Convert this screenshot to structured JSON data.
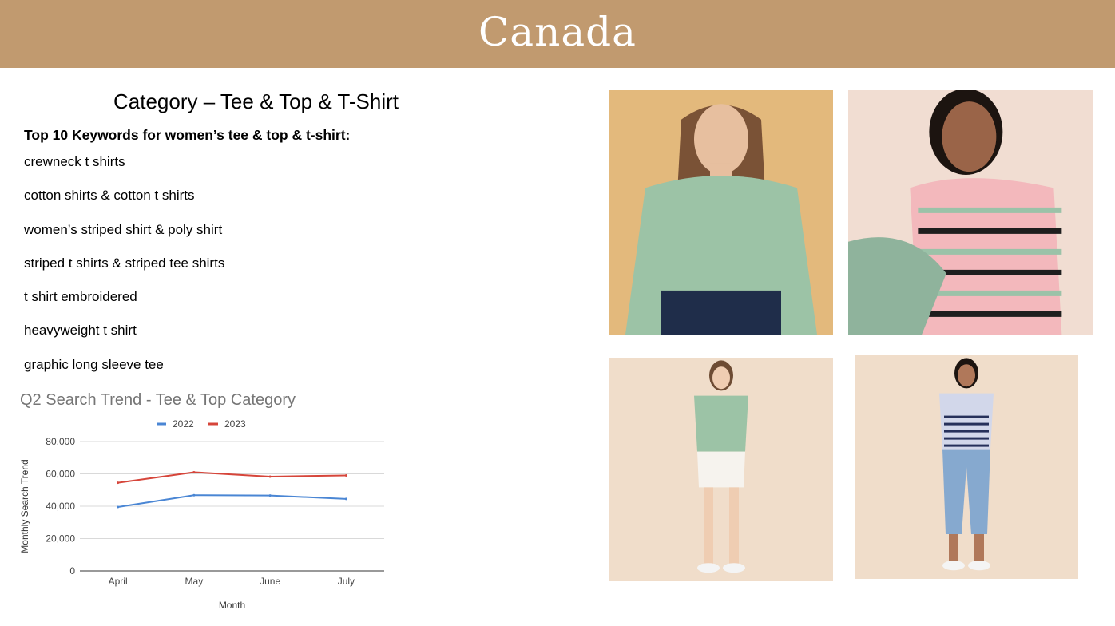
{
  "banner": {
    "title": "Canada"
  },
  "content": {
    "heading": "Category – Tee & Top & T-Shirt",
    "subheading": "Top 10 Keywords for women’s tee & top & t-shirt:",
    "keywords": [
      "crewneck t shirts",
      "cotton shirts & cotton t shirts",
      "women’s striped shirt & poly shirt",
      "striped t shirts & striped tee shirts",
      "t shirt embroidered",
      "heavyweight t shirt",
      "graphic long sleeve tee"
    ]
  },
  "chart_data": {
    "type": "line",
    "title": "Q2 Search Trend - Tee & Top Category",
    "xlabel": "Month",
    "ylabel": "Monthly Search Trend",
    "categories": [
      "April",
      "May",
      "June",
      "July"
    ],
    "series": [
      {
        "name": "2022",
        "values": [
          39500,
          46800,
          46600,
          44500
        ],
        "color": "#4a86d4"
      },
      {
        "name": "2023",
        "values": [
          54500,
          61000,
          58300,
          59000
        ],
        "color": "#d6453a"
      }
    ],
    "ylim": [
      0,
      80000
    ],
    "yticks": [
      0,
      20000,
      40000,
      60000,
      80000
    ],
    "ytick_labels": [
      "0",
      "20,000",
      "40,000",
      "60,000",
      "80,000"
    ],
    "legend": "top",
    "grid": true
  },
  "photos": [
    {
      "name": "model-floral-sweater",
      "bg": "#e3b97c",
      "top": "#9cc3a6",
      "bottom": "#1f2d4a",
      "skin": "#e7bf9f",
      "hair": "#7a5236"
    },
    {
      "name": "model-striped-tee",
      "bg": "#f1ddd2",
      "top": "#f3b8bc",
      "bottom": "#8fb39c",
      "skin": "#9a6448",
      "hair": "#1c1410"
    },
    {
      "name": "model-green-tee-shorts",
      "bg": "#f0ddca",
      "top": "#9cc3a6",
      "bottom": "#f6f3ee",
      "skin": "#efcdb2",
      "hair": "#6d4b33"
    },
    {
      "name": "model-striped-tee-capris",
      "bg": "#f0ddca",
      "top": "#d2d7ea",
      "bottom": "#86a9cf",
      "skin": "#b0785a",
      "hair": "#1c1410"
    }
  ]
}
